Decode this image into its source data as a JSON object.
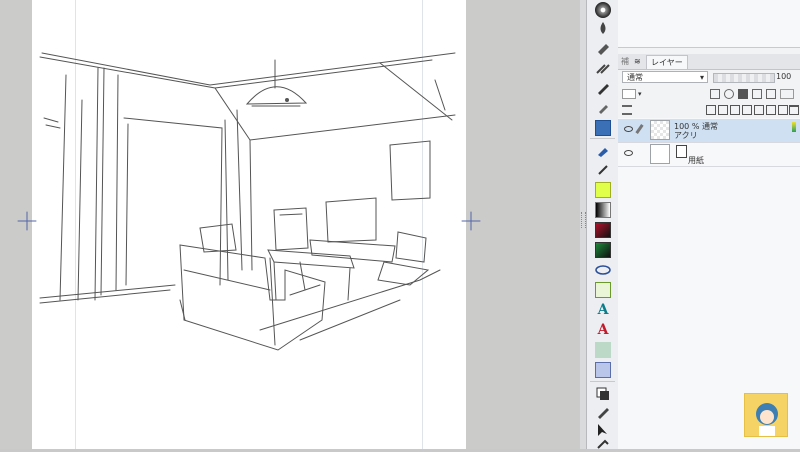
{
  "layers_panel": {
    "tab_small": "補",
    "tab_label": "レイヤー",
    "blend_mode": "通常",
    "opacity_value": "100",
    "layers": [
      {
        "info_line1": "100 % 通常",
        "info_line2": "アクリ",
        "thumbnail": "checker"
      },
      {
        "info_line2": "用紙",
        "thumbnail": "paper"
      }
    ]
  },
  "tools": [
    "color-wheel-icon",
    "water-drop-icon",
    "eraser-icon",
    "eraser-alt-icon",
    "pen-icon",
    "marker-icon",
    "selection-icon",
    "fill-icon",
    "brush-icon",
    "eraser-small-icon",
    "tone-icon",
    "gradient-icon",
    "red-gradient-icon",
    "green-gradient-icon",
    "ellipse-icon",
    "ruler-icon",
    "text-icon",
    "text-red-icon",
    "figure-icon",
    "perspective-icon",
    "layer-move-icon",
    "pen-tool-icon",
    "cursor-icon",
    "fill-bucket-icon"
  ]
}
